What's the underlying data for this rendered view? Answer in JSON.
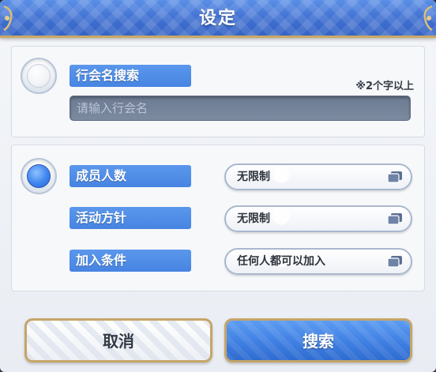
{
  "dialog": {
    "title": "设定"
  },
  "guild_name_section": {
    "label": "行会名搜索",
    "hint": "※2个字以上",
    "input_placeholder": "请输入行会名",
    "input_value": "",
    "radio_selected": false
  },
  "filter_section": {
    "radio_selected": true,
    "rows": [
      {
        "label": "成员人数",
        "value": "无限制"
      },
      {
        "label": "活动方针",
        "value": "无限制"
      },
      {
        "label": "加入条件",
        "value": "任何人都可以加入"
      }
    ]
  },
  "buttons": {
    "cancel_label": "取消",
    "search_label": "搜索"
  },
  "colors": {
    "accent_blue": "#4784e2",
    "gold_border": "#c5a568",
    "input_bg": "#7d8ba1"
  },
  "icons": {
    "select_icon": "window-copy-icon",
    "corner_ornament": "gold-ornament-icon"
  }
}
